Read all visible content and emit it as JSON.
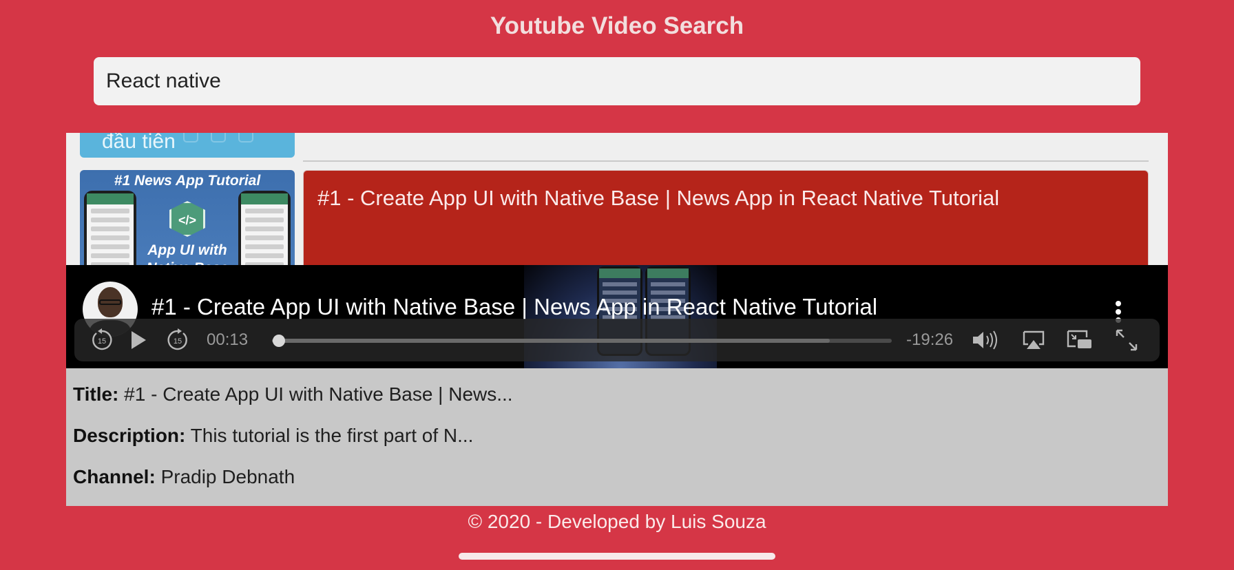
{
  "header": {
    "title": "Youtube Video Search"
  },
  "search": {
    "value": "React native",
    "placeholder": ""
  },
  "results": {
    "partial_item": {
      "thumbnail_text": "đầu tiên"
    },
    "selected_item": {
      "title": "#1 - Create App UI with Native Base | News App in React Native Tutorial",
      "thumbnail_heading": "#1 News App Tutorial",
      "thumbnail_badge": "</>",
      "thumbnail_subtitle": "App UI with Native Base"
    }
  },
  "player": {
    "title": "#1 - Create App UI with Native Base | News App in React Native Tutorial",
    "elapsed": "00:13",
    "remaining": "-19:26",
    "progress": 0.011,
    "buffered": 0.9,
    "skip_back_seconds": "15",
    "skip_forward_seconds": "15",
    "icons": [
      "replay-15-icon",
      "play-icon",
      "forward-15-icon",
      "volume-icon",
      "airplay-icon",
      "picture-in-picture-icon",
      "fullscreen-icon",
      "more-vertical-icon"
    ]
  },
  "details": {
    "title_label": "Title:",
    "title_value": "#1 - Create App UI with Native Base | News...",
    "description_label": "Description:",
    "description_value": "This tutorial is the first part of N...",
    "channel_label": "Channel:",
    "channel_value": "Pradip Debnath"
  },
  "footer": {
    "text": "© 2020 - Developed by Luis Souza"
  },
  "colors": {
    "background": "#d53646",
    "selected_card": "#b5241a",
    "details_panel": "#c8c8c8",
    "player": "#000000"
  }
}
